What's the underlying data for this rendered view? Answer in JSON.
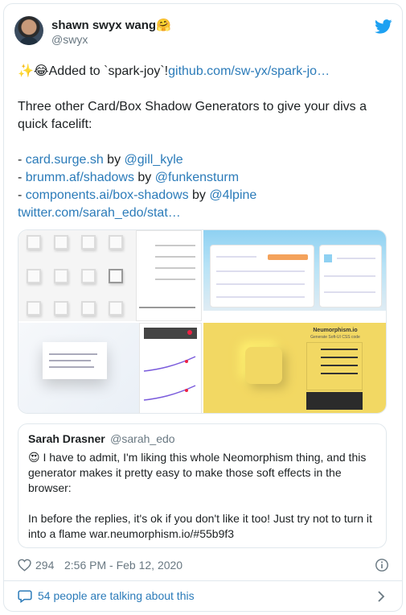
{
  "author": {
    "name": "shawn swyx wang🤗",
    "handle": "@swyx"
  },
  "tweet": {
    "line1_prefix": "✨😂Added to `spark-joy`!",
    "line1_link": "github.com/sw-yx/spark-jo…",
    "intro": "Three other Card/Box Shadow Generators to give your divs a quick facelift:",
    "items": [
      {
        "bullet": "- ",
        "link": "card.surge.sh",
        "by": " by ",
        "mention": "@gill_kyle"
      },
      {
        "bullet": "- ",
        "link": "brumm.af/shadows",
        "by": " by ",
        "mention": "@funkensturm"
      },
      {
        "bullet": "- ",
        "link": "components.ai/box-shadows",
        "by": " by ",
        "mention": "@4lpine"
      }
    ],
    "quoted_link": "twitter.com/sarah_edo/stat…"
  },
  "quote": {
    "name": "Sarah Drasner",
    "handle": "@sarah_edo",
    "para1": "😍 I have to admit, I'm liking this whole Neomorphism thing, and this generator makes it pretty easy to make those soft effects in the browser:",
    "para2": "In before the replies, it's ok if you don't like it too! Just try not to turn it into a flame war.neumorphism.io/#55b9f3"
  },
  "meta": {
    "likes": "294",
    "timestamp": "2:56 PM - Feb 12, 2020"
  },
  "footer": {
    "talking": "54 people are talking about this"
  },
  "media": {
    "neumorphism_title": "Neumorphism.io",
    "neumorphism_subtitle": "Generate Soft-UI CSS code"
  },
  "icons": {
    "twitter": "twitter-bird-icon",
    "heart": "heart-icon",
    "info": "info-icon",
    "bubble": "chat-bubble-icon",
    "chevron": "chevron-right-icon"
  },
  "colors": {
    "link": "#2b7bb9",
    "twitter_blue": "#1da1f2",
    "muted": "#697882",
    "neumorphism_bg": "#f2d863"
  }
}
